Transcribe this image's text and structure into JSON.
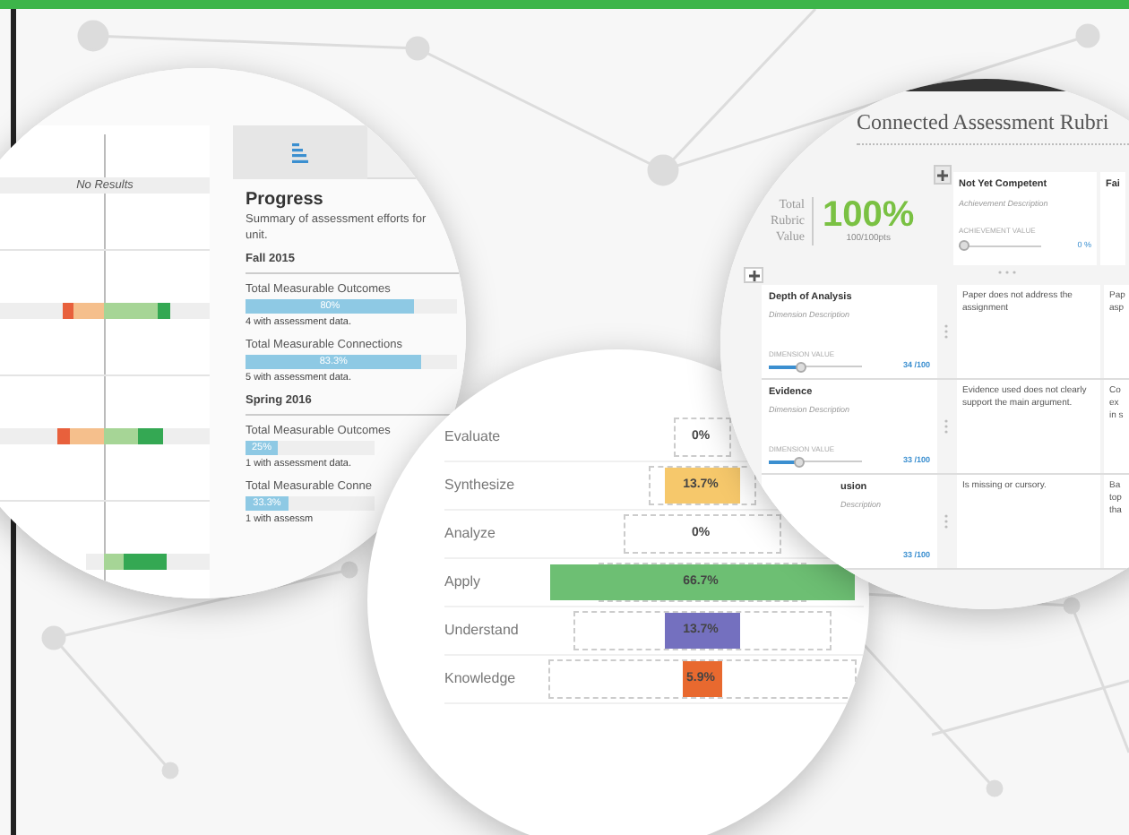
{
  "progress_view": {
    "result_rows": [
      {
        "kind": "empty",
        "text": "No Results"
      },
      {
        "kind": "bar"
      },
      {
        "kind": "bar"
      },
      {
        "kind": "bar"
      }
    ],
    "title": "Progress",
    "summary": [
      "Summary of assessment efforts for",
      "unit."
    ],
    "terms": [
      {
        "name": "Fall 2015",
        "items": [
          {
            "label": "Total Measurable Outcomes",
            "level": 0.8,
            "reading": "80%",
            "note": "4 with assessment data."
          },
          {
            "label": "Total Measurable Connections",
            "level": 0.833,
            "reading": "83.3%",
            "note": "5 with assessment data."
          }
        ]
      },
      {
        "name": "Spring 2016",
        "items": [
          {
            "label": "Total Measurable Outcomes",
            "level": 0.25,
            "reading": "25%",
            "note": "1 with assessment data."
          },
          {
            "label": "Total Measurable Conne",
            "level": 0.333,
            "reading": "33.3%",
            "note": "1 with assessm"
          }
        ]
      }
    ]
  },
  "taxonomy": {
    "rows": [
      {
        "label": "Evaluate",
        "value": "0%"
      },
      {
        "label": "Synthesize",
        "value": "13.7%",
        "color": "#f6c86b"
      },
      {
        "label": "Analyze",
        "value": "0%"
      },
      {
        "label": "Apply",
        "value": "66.7%",
        "color": "#6dbf73"
      },
      {
        "label": "Understand",
        "value": "13.7%",
        "color": "#7470bf"
      },
      {
        "label": "Knowledge",
        "value": "5.9%",
        "color": "#e8692f"
      }
    ]
  },
  "rubric": {
    "title": "Connected Assessment Rubri",
    "total_label": "Total Rubric Value",
    "total_value": "100%",
    "total_points": "100/100pts",
    "columns": [
      {
        "title": "Not Yet Competent",
        "description": "Achievement Description",
        "value_label": "ACHIEVEMENT VALUE",
        "level": 0,
        "value": "0 %"
      },
      {
        "title": "Fai"
      }
    ],
    "rows": [
      {
        "title": "Depth of Analysis",
        "description": "Dimension Description",
        "value_label": "DIMENSION VALUE",
        "level": 0.34,
        "value": "34 /100",
        "cells": [
          "Paper does not address the assignment",
          "Pap\nasp"
        ]
      },
      {
        "title": "Evidence",
        "description": "Dimension Description",
        "value_label": "DIMENSION VALUE",
        "level": 0.33,
        "value": "33 /100",
        "cells": [
          "Evidence used does not clearly support the main argument.",
          "Co\nex\nin s"
        ]
      },
      {
        "title": "usion",
        "description": "Description",
        "value": "33 /100",
        "cells": [
          "Is missing or cursory.",
          "Ba\ntop\ntha"
        ]
      }
    ]
  }
}
